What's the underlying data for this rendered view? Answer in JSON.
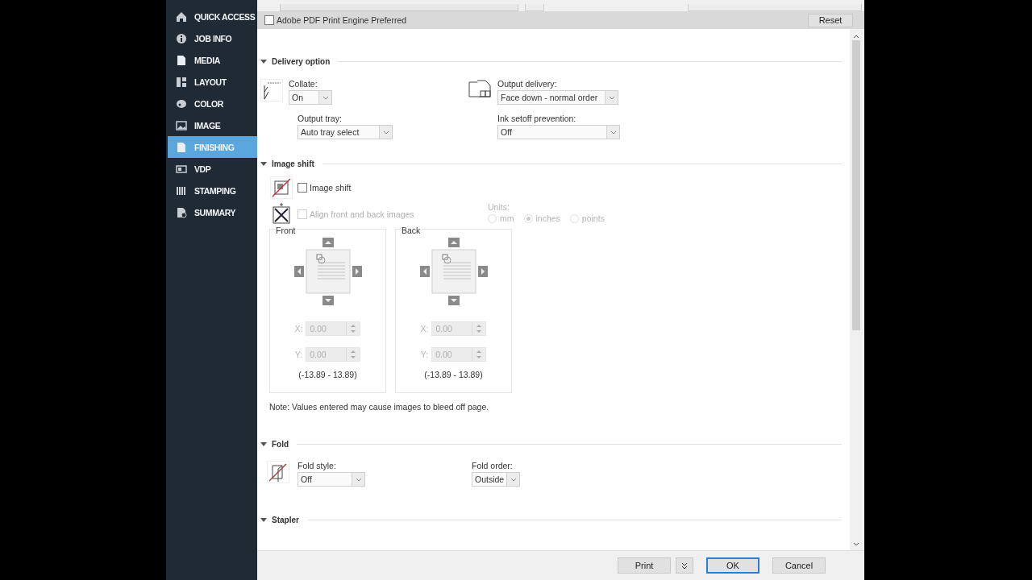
{
  "sidebar": {
    "items": [
      {
        "label": "QUICK ACCESS",
        "kind": "home",
        "selected": false
      },
      {
        "label": "JOB INFO",
        "kind": "info",
        "selected": false
      },
      {
        "label": "MEDIA",
        "kind": "page",
        "selected": false
      },
      {
        "label": "LAYOUT",
        "kind": "layout",
        "selected": false
      },
      {
        "label": "COLOR",
        "kind": "palette",
        "selected": false
      },
      {
        "label": "IMAGE",
        "kind": "image",
        "selected": false
      },
      {
        "label": "FINISHING",
        "kind": "page",
        "selected": true
      },
      {
        "label": "VDP",
        "kind": "vdp",
        "selected": false
      },
      {
        "label": "STAMPING",
        "kind": "bars",
        "selected": false
      },
      {
        "label": "SUMMARY",
        "kind": "summary",
        "selected": false
      }
    ]
  },
  "header": {
    "engine_checkbox": {
      "label": "Adobe PDF Print Engine Preferred",
      "checked": false
    },
    "reset_button": "Reset"
  },
  "delivery_option": {
    "title": "Delivery option",
    "expanded": true,
    "collate": {
      "label": "Collate:",
      "value": "On"
    },
    "output_delivery": {
      "label": "Output delivery:",
      "value": "Face down - normal order"
    },
    "output_tray": {
      "label": "Output tray:",
      "value": "Auto tray select"
    },
    "ink_setoff": {
      "label": "Ink setoff prevention:",
      "value": "Off"
    }
  },
  "image_shift": {
    "title": "Image shift",
    "expanded": true,
    "shift_checkbox": {
      "label": "Image shift",
      "checked": false,
      "disabled": false
    },
    "align_checkbox": {
      "label": "Align front and back images",
      "checked": false,
      "disabled": true
    },
    "units": {
      "label": "Units:",
      "disabled": true,
      "options": [
        {
          "label": "mm",
          "selected": false
        },
        {
          "label": "inches",
          "selected": true
        },
        {
          "label": "points",
          "selected": false
        }
      ]
    },
    "panels": [
      {
        "title": "Front",
        "x_label": "X:",
        "x_value": "0.00",
        "y_label": "Y:",
        "y_value": "0.00",
        "range": "(-13.89 - 13.89)"
      },
      {
        "title": "Back",
        "x_label": "X:",
        "x_value": "0.00",
        "y_label": "Y:",
        "y_value": "0.00",
        "range": "(-13.89 - 13.89)"
      }
    ],
    "note": "Note: Values entered may cause images to bleed off page."
  },
  "fold": {
    "title": "Fold",
    "expanded": true,
    "fold_style": {
      "label": "Fold style:",
      "value": "Off"
    },
    "fold_order": {
      "label": "Fold order:",
      "value": "Outside"
    }
  },
  "stapler": {
    "title": "Stapler",
    "expanded": true
  },
  "footer": {
    "print_button": "Print",
    "ok_button": "OK",
    "cancel_button": "Cancel"
  }
}
